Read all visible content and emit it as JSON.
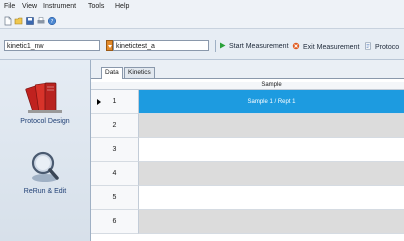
{
  "menu": [
    {
      "label": "File"
    },
    {
      "label": "View"
    },
    {
      "label": "Instrument"
    },
    {
      "label": "Tools"
    },
    {
      "label": "Help"
    }
  ],
  "toolbar": {
    "protocol_value": "kinetic1_nw",
    "run_name_value": "kinetictest_a",
    "start_label": "Start Measurement",
    "exit_label": "Exit Measurement",
    "protocol_label": "Protoco"
  },
  "sidebar": {
    "items": [
      {
        "label": "Protocol Design",
        "icon": "binders-icon"
      },
      {
        "label": "ReRun & Edit",
        "icon": "magnifier-icon"
      }
    ]
  },
  "tabs": [
    {
      "label": "Data",
      "active": true
    },
    {
      "label": "Kinetics",
      "active": false
    }
  ],
  "grid": {
    "column_header": "Sample",
    "rows": [
      {
        "num": "1",
        "sample": "Sample 1 / Rept 1",
        "selected": true
      },
      {
        "num": "2",
        "sample": ""
      },
      {
        "num": "3",
        "sample": ""
      },
      {
        "num": "4",
        "sample": ""
      },
      {
        "num": "5",
        "sample": ""
      },
      {
        "num": "6",
        "sample": ""
      }
    ]
  },
  "colors": {
    "selected_row": "#1d9be0",
    "even_row": "#dcdcdc",
    "odd_row": "#ffffff",
    "sidebar_text": "#1f3f74"
  }
}
